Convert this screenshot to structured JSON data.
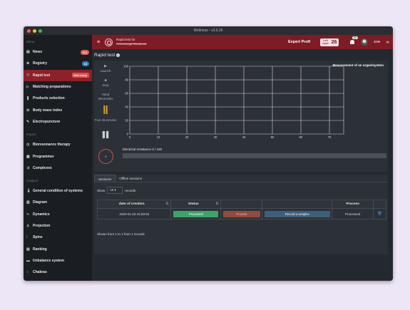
{
  "window": {
    "title": "Wellness - v3.0.26"
  },
  "topbar": {
    "patient_label": "Rapid test for",
    "patient_name": "Александр Смирнов",
    "account": "Expert Profi",
    "days_label_1": "Left",
    "days_label_2": "days",
    "days_value": "26",
    "notifications": "99+",
    "language": "EN▾"
  },
  "sidebar": {
    "menu_title": "Menu",
    "items": [
      {
        "label": "News",
        "icon": "newspaper-icon",
        "badge": "113"
      },
      {
        "label": "Registry",
        "icon": "registry-icon",
        "badge": "24"
      },
      {
        "label": "Rapid test",
        "icon": "heart-icon",
        "badge": "Not ready"
      },
      {
        "label": "Matching preparations",
        "icon": "play-icon"
      },
      {
        "label": "Products selection",
        "icon": "products-icon"
      },
      {
        "label": "Body mass index",
        "icon": "scale-icon"
      },
      {
        "label": "Electropuncture",
        "icon": "pen-icon"
      }
    ],
    "impact_title": "Impact",
    "impact_items": [
      {
        "label": "Bioresonance therapy",
        "icon": "clock-icon"
      },
      {
        "label": "Programmer",
        "icon": "programmer-icon"
      },
      {
        "label": "Complexes",
        "icon": "shuffle-icon"
      }
    ],
    "analysis_title": "Analysis",
    "analysis_items": [
      {
        "label": "General condition of systems",
        "icon": "thermometer-icon"
      },
      {
        "label": "Diagram",
        "icon": "chart-icon"
      },
      {
        "label": "Dynamics",
        "icon": "dynamics-icon"
      },
      {
        "label": "Projection",
        "icon": "person-icon"
      },
      {
        "label": "Spine",
        "icon": "spine-icon"
      },
      {
        "label": "Ranking",
        "icon": "ranking-icon"
      },
      {
        "label": "Unbalance system",
        "icon": "unbalance-icon"
      },
      {
        "label": "Chakras",
        "icon": "chakra-icon"
      }
    ]
  },
  "page": {
    "title": "Rapid test",
    "launch": "Launch",
    "stop": "Stop",
    "hand": "Hand electrodes",
    "foot": "Foot electrodes",
    "measurement_title": "Measurement of an organ/system",
    "ring_value": "0",
    "resistance_label": "Electrical resistance 0 / 100",
    "resistance_fraction": 0
  },
  "chart_data": {
    "type": "line",
    "x": [
      0,
      10,
      20,
      30,
      40,
      50,
      60,
      70
    ],
    "xlim": [
      0,
      75
    ],
    "ylim": [
      0,
      100
    ],
    "yticks": [
      0,
      20,
      40,
      60,
      80,
      100
    ],
    "series": [],
    "grid": true
  },
  "sessions": {
    "tabs": [
      "Sessions",
      "Offline sessions"
    ],
    "show_label": "Show",
    "show_value": "10",
    "records_label": "records",
    "columns": [
      "date of creation",
      "Status",
      "",
      "",
      "Process",
      ""
    ],
    "rows": [
      {
        "date": "2020-01-23 15:03:03",
        "status": "Processed",
        "process_btn": "Process",
        "record_btn": "Record a complex",
        "process": "Processed"
      }
    ],
    "footer": "Shown from 1 to 1 from 1 records"
  }
}
